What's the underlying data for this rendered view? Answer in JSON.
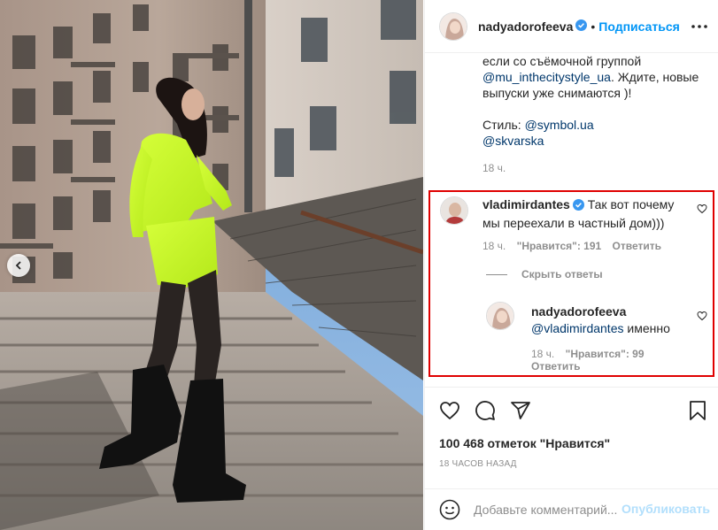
{
  "post": {
    "author": "nadyadorofeeva",
    "follow_label": "Подписаться",
    "dot": "•",
    "caption_lines": [
      "если со съёмочной группой",
      "@mu_inthecitystyle_ua",
      ". Ждите, новые выпуски уже снимаются )!"
    ],
    "style_label": "Стиль: ",
    "style_mention_1": "@symbol.ua",
    "style_mention_2": "@skvarska",
    "caption_time": "18 ч."
  },
  "comments": [
    {
      "user": "vladimirdantes",
      "text_line1": "Так вот почему",
      "text_line2": "мы переехали в частный дом)))",
      "time": "18 ч.",
      "likes": "\"Нравится\": 191",
      "reply": "Ответить",
      "hide_replies": "Скрыть ответы"
    },
    {
      "user": "nadyadorofeeva",
      "mention": "@vladimirdantes",
      "text": " именно",
      "time": "18 ч.",
      "likes": "\"Нравится\": 99",
      "reply": "Ответить"
    }
  ],
  "actions": {
    "likes_count": "100 468 отметок \"Нравится\"",
    "post_time": "18 часов назад",
    "icons": [
      "heart-icon",
      "comment-icon",
      "share-icon",
      "bookmark-icon"
    ]
  },
  "comment_box": {
    "placeholder": "Добавьте комментарий...",
    "publish": "Опубликовать"
  },
  "colors": {
    "accent": "#0095f6",
    "highlight": "#e00000",
    "muted": "#8e8e8e",
    "mention": "#00376b"
  }
}
